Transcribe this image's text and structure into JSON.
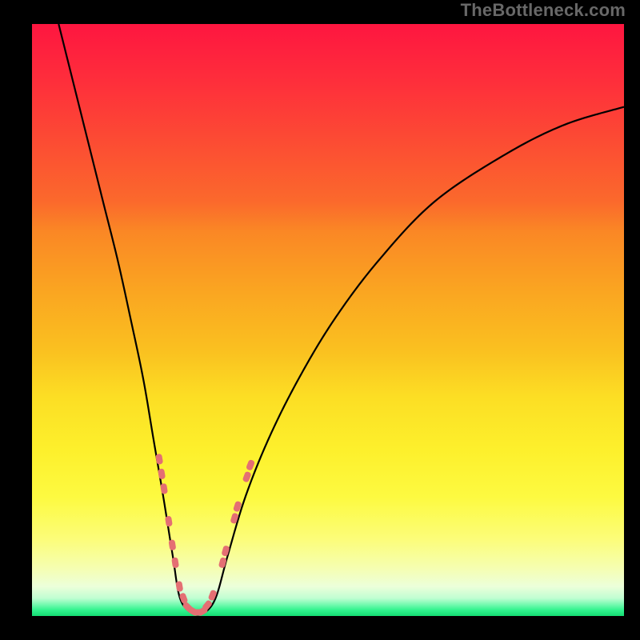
{
  "watermark": "TheBottleneck.com",
  "colors": {
    "curve": "#000000",
    "marker": "#e46f73",
    "background_frame": "#000000"
  },
  "chart_data": {
    "type": "line",
    "title": "",
    "xlabel": "",
    "ylabel": "",
    "ylim": [
      0,
      100
    ],
    "xlim": [
      0,
      100
    ],
    "curve": {
      "points": [
        {
          "x": 4.5,
          "y": 100
        },
        {
          "x": 7.0,
          "y": 90
        },
        {
          "x": 9.5,
          "y": 80
        },
        {
          "x": 12.0,
          "y": 70
        },
        {
          "x": 14.5,
          "y": 60
        },
        {
          "x": 16.7,
          "y": 50
        },
        {
          "x": 18.8,
          "y": 40
        },
        {
          "x": 20.5,
          "y": 30
        },
        {
          "x": 22.2,
          "y": 20
        },
        {
          "x": 23.8,
          "y": 10
        },
        {
          "x": 25.0,
          "y": 3
        },
        {
          "x": 27.0,
          "y": 0.5
        },
        {
          "x": 29.0,
          "y": 0.5
        },
        {
          "x": 31.0,
          "y": 3
        },
        {
          "x": 33.0,
          "y": 10
        },
        {
          "x": 36.0,
          "y": 20
        },
        {
          "x": 40.0,
          "y": 30
        },
        {
          "x": 45.0,
          "y": 40
        },
        {
          "x": 51.0,
          "y": 50
        },
        {
          "x": 58.5,
          "y": 60
        },
        {
          "x": 68.0,
          "y": 70
        },
        {
          "x": 80.0,
          "y": 78
        },
        {
          "x": 90.0,
          "y": 83
        },
        {
          "x": 100.0,
          "y": 86
        }
      ]
    },
    "markers": [
      {
        "x": 21.5,
        "y": 26.5
      },
      {
        "x": 21.9,
        "y": 24.0
      },
      {
        "x": 22.3,
        "y": 21.5
      },
      {
        "x": 23.1,
        "y": 16.0
      },
      {
        "x": 23.7,
        "y": 12.0
      },
      {
        "x": 24.2,
        "y": 9.0
      },
      {
        "x": 24.9,
        "y": 5.0
      },
      {
        "x": 25.6,
        "y": 3.0
      },
      {
        "x": 26.3,
        "y": 1.5
      },
      {
        "x": 27.2,
        "y": 0.8
      },
      {
        "x": 28.0,
        "y": 0.6
      },
      {
        "x": 28.8,
        "y": 0.8
      },
      {
        "x": 29.6,
        "y": 1.8
      },
      {
        "x": 30.5,
        "y": 3.5
      },
      {
        "x": 32.2,
        "y": 9.0
      },
      {
        "x": 32.7,
        "y": 11.0
      },
      {
        "x": 34.2,
        "y": 16.5
      },
      {
        "x": 34.7,
        "y": 18.5
      },
      {
        "x": 36.3,
        "y": 23.5
      },
      {
        "x": 36.9,
        "y": 25.5
      }
    ]
  }
}
